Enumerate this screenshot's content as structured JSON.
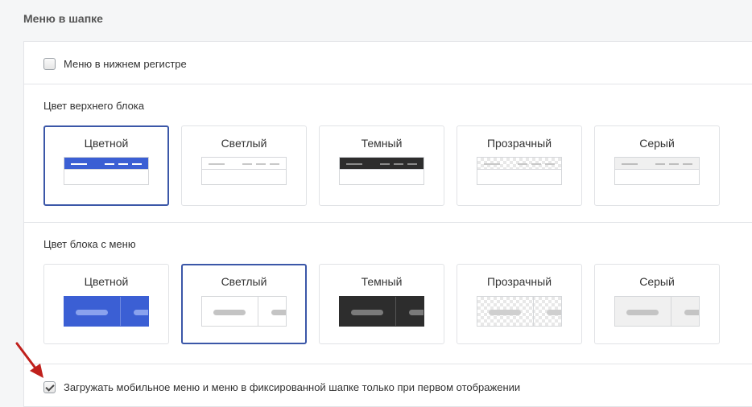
{
  "section": {
    "title": "Меню в шапке"
  },
  "lowercase_option": {
    "label": "Меню в нижнем регистре",
    "checked": false
  },
  "top_block": {
    "label": "Цвет верхнего блока",
    "selected": "Цветной",
    "options": [
      {
        "label": "Цветной",
        "bar_color": "#3b5fd4",
        "dash_color": "#ffffff"
      },
      {
        "label": "Светлый",
        "bar_color": "#ffffff",
        "dash_color": "#c8c8c8"
      },
      {
        "label": "Темный",
        "bar_color": "#2d2d2d",
        "dash_color": "#8a8a8a"
      },
      {
        "label": "Прозрачный",
        "bar_color": "checker",
        "dash_color": "#c8c8c8"
      },
      {
        "label": "Серый",
        "bar_color": "#f0f0f0",
        "dash_color": "#bdbdbd"
      }
    ]
  },
  "menu_block": {
    "label": "Цвет блока с меню",
    "selected": "Светлый",
    "options": [
      {
        "label": "Цветной",
        "bg_color": "#3b5fd4",
        "pill_color": "#8aa2ee"
      },
      {
        "label": "Светлый",
        "bg_color": "#ffffff",
        "pill_color": "#c4c4c4"
      },
      {
        "label": "Темный",
        "bg_color": "#2d2d2d",
        "pill_color": "#7a7a7a"
      },
      {
        "label": "Прозрачный",
        "bg_color": "checker",
        "pill_color": "#cfcfcf"
      },
      {
        "label": "Серый",
        "bg_color": "#f0f0f0",
        "pill_color": "#c4c4c4"
      }
    ]
  },
  "lazy_load_option": {
    "label": "Загружать мобильное меню и меню в фиксированной шапке только при первом отображении",
    "checked": true
  },
  "accent_color": "#3b57a8",
  "annotation": {
    "icon": "red-arrow-icon",
    "color": "#c0201c"
  }
}
